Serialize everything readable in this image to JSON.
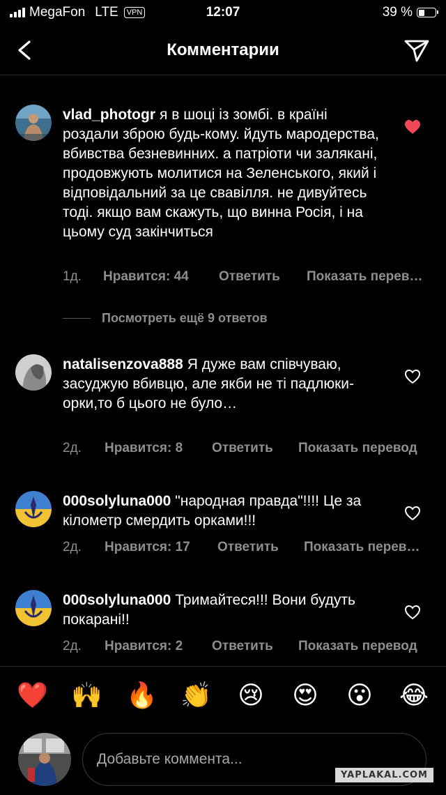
{
  "status_bar": {
    "carrier": "MegaFon",
    "network": "LTE",
    "vpn": "VPN",
    "time": "12:07",
    "battery_percent_text": "39 %",
    "battery_level": 0.39
  },
  "header": {
    "title": "Комментарии",
    "back_icon": "chevron-left-icon",
    "share_icon": "paper-plane-icon"
  },
  "comments": [
    {
      "username": "vlad_photogr",
      "text": "я в шоці із зомбі.  в країні роздали зброю будь-кому.  йдуть мародерства, вбивства безневинних.  а патріоти чи залякані, продовжують молитися на Зеленського, який і відповідальний за це свавілля.  не дивуйтесь тоді.  якщо вам скажуть, що винна Росія, і на цьому суд закінчиться",
      "time": "1д.",
      "likes": "Нравится: 44",
      "reply": "Ответить",
      "translate": "Показать перев…",
      "liked": true
    },
    {
      "username": "natalisenzova888",
      "text": "Я дуже вам співчуваю, засуджую вбивцю, але якби не ті падлюки-орки,то б цього не було…",
      "time": "2д.",
      "likes": "Нравится: 8",
      "reply": "Ответить",
      "translate": "Показать перевод",
      "liked": false
    },
    {
      "username": "000solyluna000",
      "text": "\"народная правда\"!!!! Це за кілометр смердить орками!!!",
      "time": "2д.",
      "likes": "Нравится: 17",
      "reply": "Ответить",
      "translate": "Показать перев…",
      "liked": false
    },
    {
      "username": "000solyluna000",
      "text": "Тримайтеся!!! Вони будуть покарані!!",
      "time": "2д.",
      "likes": "Нравится: 2",
      "reply": "Ответить",
      "translate": "Показать перевод",
      "liked": false
    }
  ],
  "view_replies": "Посмотреть ещё 9 ответов",
  "emojis": [
    "❤️",
    "🙌",
    "🔥",
    "👏",
    "😢",
    "😍",
    "😮",
    "😂"
  ],
  "input": {
    "placeholder": "Добавьте коммента..."
  },
  "watermark": "YAPLAKAL.COM",
  "colors": {
    "background": "#000000",
    "secondary_text": "#8e8e8e",
    "like_red": "#ed4956"
  }
}
